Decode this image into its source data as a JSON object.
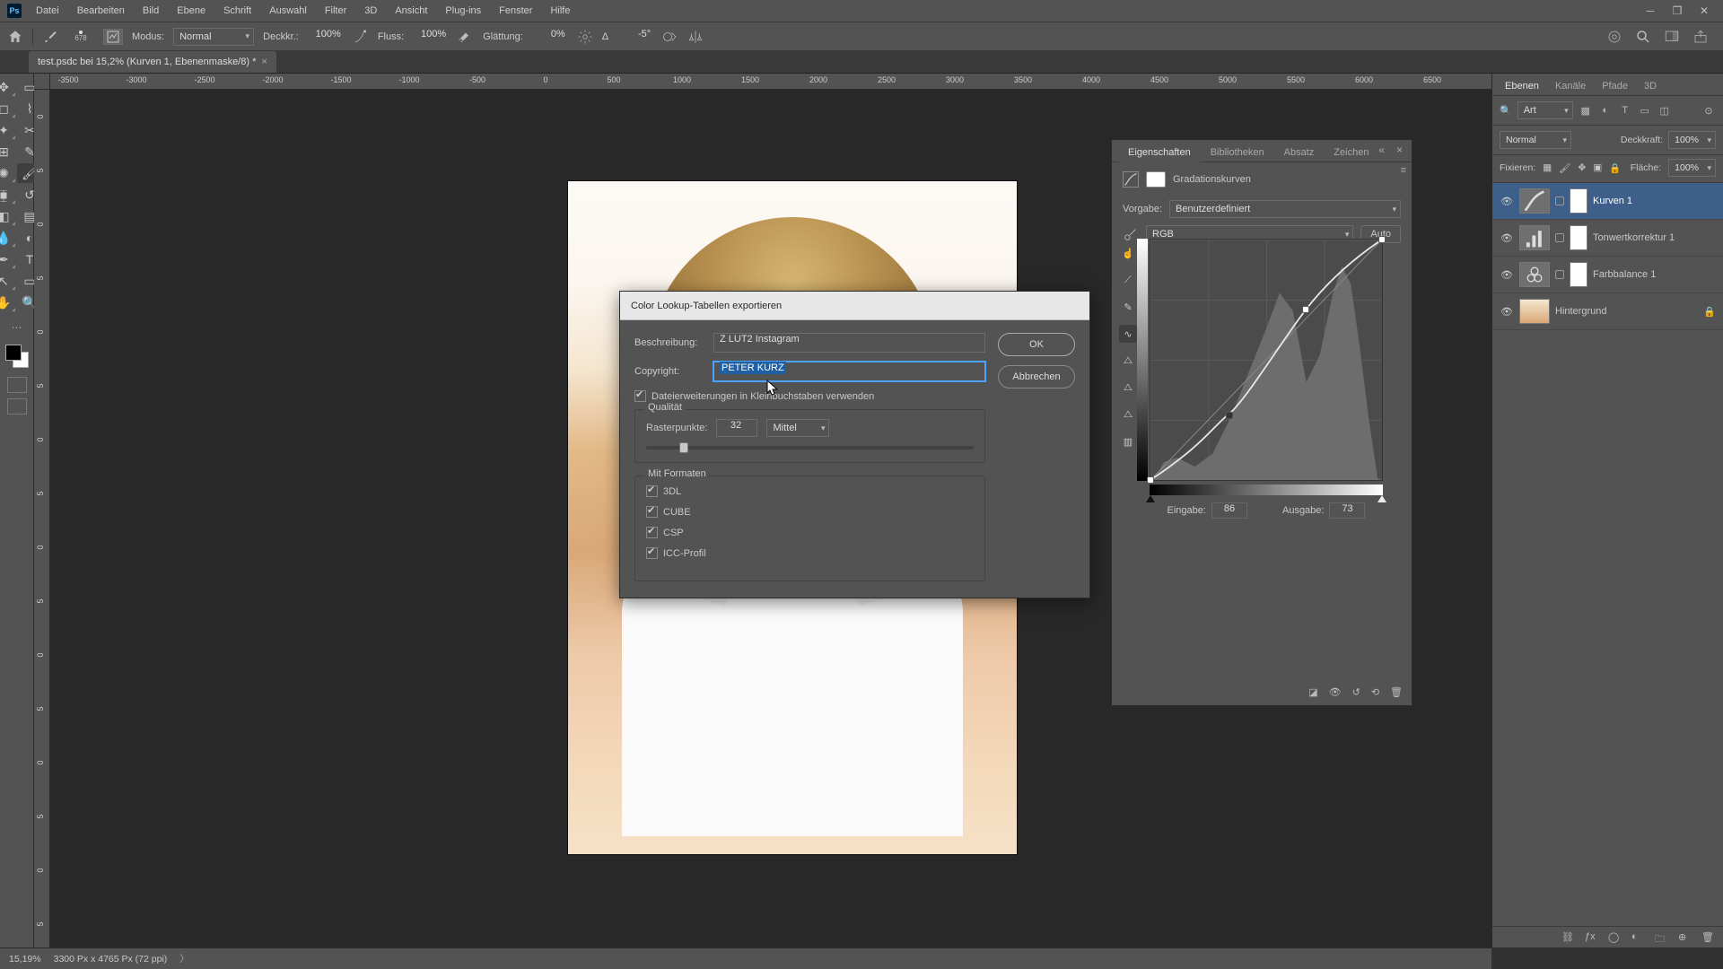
{
  "menu": {
    "items": [
      "Datei",
      "Bearbeiten",
      "Bild",
      "Ebene",
      "Schrift",
      "Auswahl",
      "Filter",
      "3D",
      "Ansicht",
      "Plug-ins",
      "Fenster",
      "Hilfe"
    ]
  },
  "options": {
    "brush_size": "678",
    "mode_label": "Modus:",
    "mode_value": "Normal",
    "opacity_label": "Deckkr.:",
    "opacity_value": "100%",
    "flow_label": "Fluss:",
    "flow_value": "100%",
    "smooth_label": "Glättung:",
    "smooth_value": "0%",
    "angle_label": "Δ",
    "angle_value": "-5°"
  },
  "tab": {
    "title": "test.psdc bei 15,2% (Kurven 1, Ebenenmaske/8) *"
  },
  "ruler_h": [
    "-3500",
    "-3000",
    "-2500",
    "-2000",
    "-1500",
    "-1000",
    "-500",
    "0",
    "500",
    "1000",
    "1500",
    "2000",
    "2500",
    "3000",
    "3500",
    "4000",
    "4500",
    "5000",
    "5500",
    "6000",
    "6500"
  ],
  "ruler_v": [
    "0",
    "5",
    "0",
    "5",
    "0",
    "5",
    "0",
    "5",
    "0",
    "5",
    "0",
    "5",
    "0",
    "5",
    "0",
    "5"
  ],
  "dialog": {
    "title": "Color Lookup-Tabellen exportieren",
    "desc_label": "Beschreibung:",
    "desc_value": "Z LUT2 Instagram",
    "copy_label": "Copyright:",
    "copy_value": "PETER KURZ",
    "lowercase_label": "Dateierweiterungen in Kleinbuchstaben verwenden",
    "quality_legend": "Qualität",
    "raster_label": "Rasterpunkte:",
    "raster_value": "32",
    "raster_preset": "Mittel",
    "formats_legend": "Mit Formaten",
    "fmt": [
      "3DL",
      "CUBE",
      "CSP",
      "ICC-Profil"
    ],
    "ok": "OK",
    "cancel": "Abbrechen"
  },
  "properties": {
    "tabs": [
      "Eigenschaften",
      "Bibliotheken",
      "Absatz",
      "Zeichen"
    ],
    "type": "Gradationskurven",
    "preset_label": "Vorgabe:",
    "preset_value": "Benutzerdefiniert",
    "channel": "RGB",
    "auto": "Auto",
    "input_label": "Eingabe:",
    "input_value": "86",
    "output_label": "Ausgabe:",
    "output_value": "73"
  },
  "layers_panel": {
    "tabs": [
      "Ebenen",
      "Kanäle",
      "Pfade",
      "3D"
    ],
    "filter_type": "Art",
    "blend_mode": "Normal",
    "opacity_label": "Deckkraft:",
    "opacity_value": "100%",
    "lock_label": "Fixieren:",
    "fill_label": "Fläche:",
    "fill_value": "100%",
    "layers": [
      {
        "name": "Kurven 1",
        "kind": "adj-curves"
      },
      {
        "name": "Tonwertkorrektur 1",
        "kind": "adj-levels"
      },
      {
        "name": "Farbbalance 1",
        "kind": "adj-balance"
      },
      {
        "name": "Hintergrund",
        "kind": "bg"
      }
    ]
  },
  "status": {
    "zoom": "15,19%",
    "docinfo": "3300 Px x 4765 Px (72 ppi)"
  }
}
